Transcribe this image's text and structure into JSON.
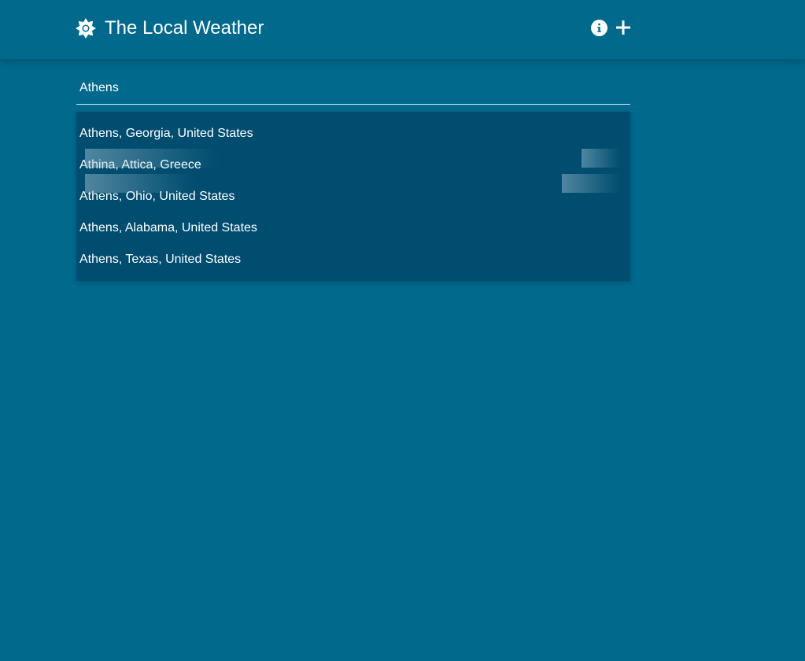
{
  "header": {
    "title": "The Local Weather",
    "logo_icon": "sun-icon",
    "info_icon": "info-icon",
    "add_icon": "plus-icon"
  },
  "search": {
    "value": "Athens"
  },
  "suggestions": [
    {
      "label": "Athens, Georgia, United States"
    },
    {
      "label": "Athina, Attica, Greece"
    },
    {
      "label": "Athens, Ohio, United States"
    },
    {
      "label": "Athens, Alabama, United States"
    },
    {
      "label": "Athens, Texas, United States"
    }
  ],
  "colors": {
    "background": "#00698c",
    "dropdown": "#004d70",
    "text": "#ffffff"
  }
}
